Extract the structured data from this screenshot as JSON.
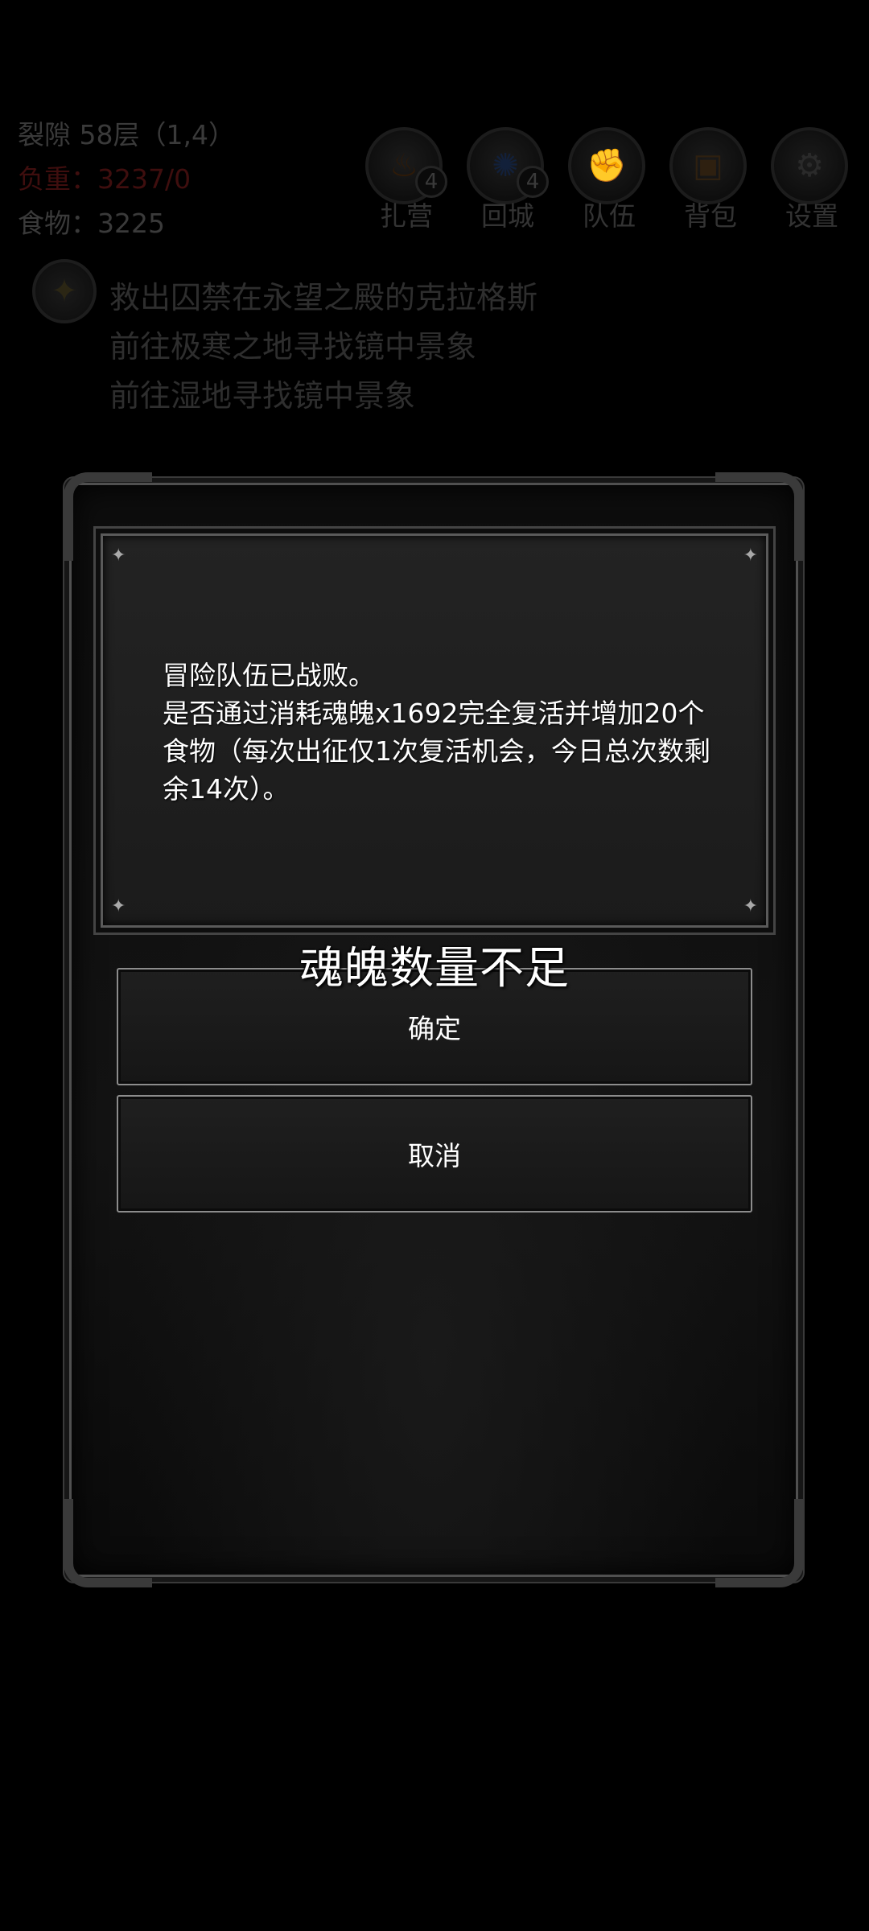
{
  "hud": {
    "location": "裂隙 58层（1,4）",
    "stat_red": "负重：3237/0",
    "food": "食物：3225",
    "buttons": [
      {
        "label": "扎营",
        "badge": "4",
        "icon": "campfire-icon"
      },
      {
        "label": "回城",
        "badge": "4",
        "icon": "portal-icon"
      },
      {
        "label": "队伍",
        "badge": "",
        "icon": "team-icon"
      },
      {
        "label": "背包",
        "badge": "",
        "icon": "backpack-icon"
      },
      {
        "label": "设置",
        "badge": "",
        "icon": "gear-icon"
      }
    ]
  },
  "quests": [
    "救出囚禁在永望之殿的克拉格斯",
    "前往极寒之地寻找镜中景象",
    "前往湿地寻找镜中景象"
  ],
  "dialog": {
    "line1": "冒险队伍已战败。",
    "line2": "是否通过消耗魂魄x1692完全复活并增加20个食物（每次出征仅1次复活机会，今日总次数剩余14次）。",
    "confirm_label": "确定",
    "cancel_label": "取消"
  },
  "toast": "魂魄数量不足",
  "colors": {
    "background": "#000000",
    "dialog_text": "#ffffff",
    "hud_dimmed": "#3a3a3a"
  }
}
